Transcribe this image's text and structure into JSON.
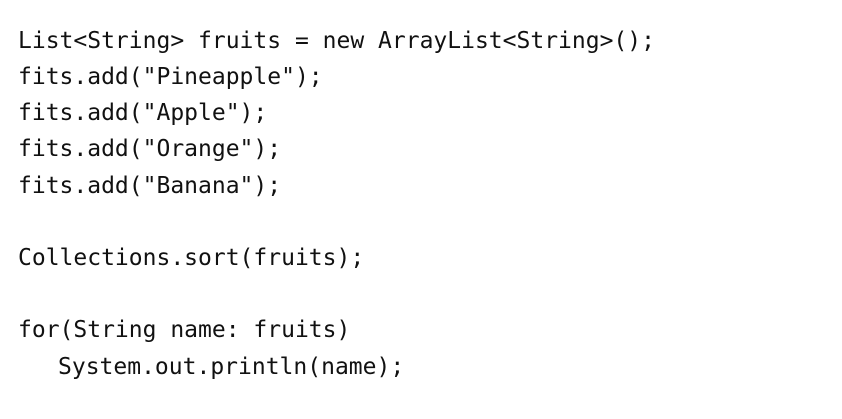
{
  "code": {
    "lines": [
      "List<String> fruits = new ArrayList<String>();",
      "fits.add(\"Pineapple\");",
      "fits.add(\"Apple\");",
      "fits.add(\"Orange\");",
      "fits.add(\"Banana\");",
      "Collections.sort(fruits);",
      "for(String name: fruits)",
      "System.out.println(name);"
    ]
  }
}
